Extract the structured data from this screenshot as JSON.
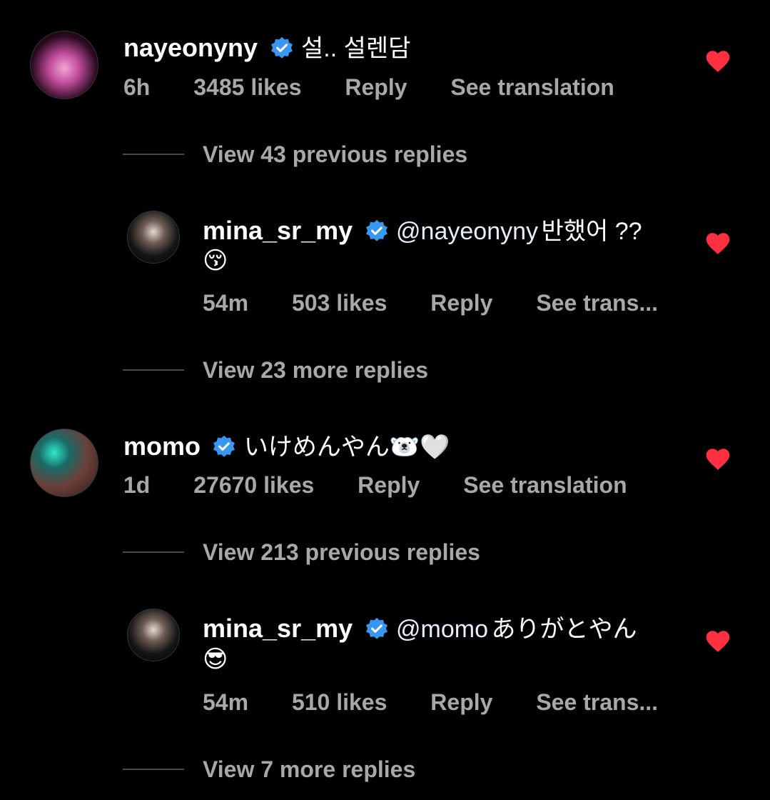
{
  "comments": [
    {
      "username": "nayeonyny",
      "text": "설.. 설렌담",
      "time": "6h",
      "likes": "3485 likes",
      "reply": "Reply",
      "translate": "See translation"
    },
    {
      "username": "momo",
      "text": "いけめんやん🐻‍❄️🤍",
      "time": "1d",
      "likes": "27670 likes",
      "reply": "Reply",
      "translate": "See translation"
    }
  ],
  "replies": [
    {
      "username": "mina_sr_my",
      "mention": "@nayeonyny",
      "text": "반했어 ??",
      "emoji": "😚",
      "time": "54m",
      "likes": "503 likes",
      "reply": "Reply",
      "translate": "See trans..."
    },
    {
      "username": "mina_sr_my",
      "mention": "@momo",
      "text": "ありがとやん",
      "emoji": "😎",
      "time": "54m",
      "likes": "510 likes",
      "reply": "Reply",
      "translate": "See trans..."
    }
  ],
  "threads": [
    "View 43 previous replies",
    "View 23 more replies",
    "View 213 previous replies",
    "View 7 more replies"
  ],
  "icons": {
    "verified": "verified-badge-icon",
    "like": "heart-icon"
  },
  "colors": {
    "background": "#000000",
    "verified": "#3897f0",
    "heart": "#ff3040",
    "secondary_text": "#a8a8a8"
  }
}
